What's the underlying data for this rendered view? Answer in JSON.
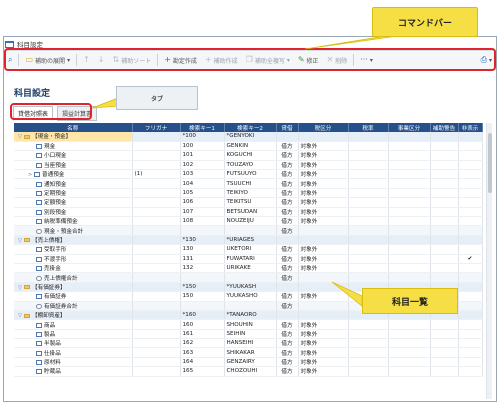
{
  "window": {
    "title": "科目設定"
  },
  "toolbar": {
    "items": [
      {
        "name": "search-icon",
        "label": "",
        "icon": "⌕",
        "dim": false
      },
      {
        "name": "expand-button",
        "label": "補助の展開",
        "icon": "▭",
        "dim": false,
        "caret": "▾"
      },
      {
        "name": "move-up-button",
        "label": "",
        "icon": "↑",
        "dim": true
      },
      {
        "name": "move-down-button",
        "label": "",
        "icon": "↓",
        "dim": true
      },
      {
        "name": "sub-sort-button",
        "label": "補助ソート",
        "icon": "⇅",
        "dim": true
      },
      {
        "name": "new-item-button",
        "label": "勘定作成",
        "icon": "+",
        "dim": false
      },
      {
        "name": "sub-create-button",
        "label": "補助作成",
        "icon": "+",
        "dim": true
      },
      {
        "name": "sub-bulk-button",
        "label": "補助全複写",
        "icon": "❐",
        "dim": true,
        "caret": "▾"
      },
      {
        "name": "edit-button",
        "label": "修正",
        "icon": "✎",
        "dim": false
      },
      {
        "name": "delete-button",
        "label": "削除",
        "icon": "✕",
        "dim": true
      },
      {
        "name": "more-button",
        "label": "",
        "icon": "···",
        "dim": false,
        "caret": "▾"
      },
      {
        "name": "print-button",
        "label": "",
        "icon": "⎙",
        "dim": false,
        "caret": "▾"
      }
    ]
  },
  "page_title": "科目設定",
  "tabs": [
    {
      "label": "貸借対照表",
      "active": true
    },
    {
      "label": "損益計算書",
      "active": false
    }
  ],
  "callouts": {
    "command_bar": "コマンドバー",
    "tab": "タブ",
    "list": "科目一覧"
  },
  "table": {
    "headers": [
      "名称",
      "フリガナ",
      "検索キー1",
      "検索キー2",
      "貸借",
      "税区分",
      "税率",
      "事業区分",
      "補助警告",
      "非表示"
    ],
    "rows": [
      {
        "kind": "group",
        "toggle": "▽",
        "icon": "folder",
        "name": "【現金・預金】",
        "furigana": "",
        "key1": "*100",
        "key2": "*GENYOKI",
        "dc": "",
        "tax": "",
        "rate": "",
        "biz": "",
        "warn": "",
        "hide": "",
        "sel": true
      },
      {
        "kind": "item",
        "toggle": "",
        "icon": "row",
        "name": "現金",
        "furigana": "",
        "key1": "100",
        "key2": "GENKIN",
        "dc": "借方",
        "tax": "対象外",
        "rate": "",
        "biz": "",
        "warn": "",
        "hide": ""
      },
      {
        "kind": "item",
        "toggle": "",
        "icon": "row",
        "name": "小口現金",
        "furigana": "",
        "key1": "101",
        "key2": "KOGUCHI",
        "dc": "借方",
        "tax": "対象外",
        "rate": "",
        "biz": "",
        "warn": "",
        "hide": ""
      },
      {
        "kind": "item",
        "toggle": "",
        "icon": "row",
        "name": "当座預金",
        "furigana": "",
        "key1": "102",
        "key2": "TOUZAYO",
        "dc": "借方",
        "tax": "対象外",
        "rate": "",
        "biz": "",
        "warn": "",
        "hide": ""
      },
      {
        "kind": "item",
        "toggle": ">",
        "icon": "row",
        "name": "普通預金",
        "furigana": "(1)",
        "key1": "103",
        "key2": "FUTSUUYO",
        "dc": "借方",
        "tax": "対象外",
        "rate": "",
        "biz": "",
        "warn": "",
        "hide": ""
      },
      {
        "kind": "item",
        "toggle": "",
        "icon": "row",
        "name": "通知預金",
        "furigana": "",
        "key1": "104",
        "key2": "TSUUCHI",
        "dc": "借方",
        "tax": "対象外",
        "rate": "",
        "biz": "",
        "warn": "",
        "hide": ""
      },
      {
        "kind": "item",
        "toggle": "",
        "icon": "row",
        "name": "定期預金",
        "furigana": "",
        "key1": "105",
        "key2": "TEIKIYO",
        "dc": "借方",
        "tax": "対象外",
        "rate": "",
        "biz": "",
        "warn": "",
        "hide": ""
      },
      {
        "kind": "item",
        "toggle": "",
        "icon": "row",
        "name": "定額預金",
        "furigana": "",
        "key1": "106",
        "key2": "TEIKITSU",
        "dc": "借方",
        "tax": "対象外",
        "rate": "",
        "biz": "",
        "warn": "",
        "hide": ""
      },
      {
        "kind": "item",
        "toggle": "",
        "icon": "row",
        "name": "別段預金",
        "furigana": "",
        "key1": "107",
        "key2": "BETSUDAN",
        "dc": "借方",
        "tax": "対象外",
        "rate": "",
        "biz": "",
        "warn": "",
        "hide": ""
      },
      {
        "kind": "item",
        "toggle": "",
        "icon": "row",
        "name": "納税準備預金",
        "furigana": "",
        "key1": "108",
        "key2": "NOUZEIJU",
        "dc": "借方",
        "tax": "対象外",
        "rate": "",
        "biz": "",
        "warn": "",
        "hide": ""
      },
      {
        "kind": "sub",
        "toggle": "",
        "icon": "sum",
        "name": "現金・預金合計",
        "furigana": "",
        "key1": "",
        "key2": "",
        "dc": "借方",
        "tax": "",
        "rate": "",
        "biz": "",
        "warn": "",
        "hide": ""
      },
      {
        "kind": "group",
        "toggle": "▽",
        "icon": "folder",
        "name": "【売上債権】",
        "furigana": "",
        "key1": "*130",
        "key2": "*URIAGES",
        "dc": "",
        "tax": "",
        "rate": "",
        "biz": "",
        "warn": "",
        "hide": ""
      },
      {
        "kind": "item",
        "toggle": "",
        "icon": "row",
        "name": "受取手形",
        "furigana": "",
        "key1": "130",
        "key2": "UKETORI",
        "dc": "借方",
        "tax": "対象外",
        "rate": "",
        "biz": "",
        "warn": "",
        "hide": ""
      },
      {
        "kind": "item",
        "toggle": "",
        "icon": "row",
        "name": "不渡手形",
        "furigana": "",
        "key1": "131",
        "key2": "FUWATARI",
        "dc": "借方",
        "tax": "対象外",
        "rate": "",
        "biz": "",
        "warn": "",
        "hide": "✔"
      },
      {
        "kind": "item",
        "toggle": "",
        "icon": "row",
        "name": "売掛金",
        "furigana": "",
        "key1": "132",
        "key2": "URIKAKE",
        "dc": "借方",
        "tax": "対象外",
        "rate": "",
        "biz": "",
        "warn": "",
        "hide": ""
      },
      {
        "kind": "sub",
        "toggle": "",
        "icon": "sum",
        "name": "売上債権合計",
        "furigana": "",
        "key1": "",
        "key2": "",
        "dc": "借方",
        "tax": "",
        "rate": "",
        "biz": "",
        "warn": "",
        "hide": ""
      },
      {
        "kind": "group",
        "toggle": "▽",
        "icon": "folder",
        "name": "【有価証券】",
        "furigana": "",
        "key1": "*150",
        "key2": "*YUUKASH",
        "dc": "",
        "tax": "",
        "rate": "",
        "biz": "",
        "warn": "",
        "hide": ""
      },
      {
        "kind": "item",
        "toggle": "",
        "icon": "row",
        "name": "有価証券",
        "furigana": "",
        "key1": "150",
        "key2": "YUUKASHO",
        "dc": "借方",
        "tax": "対象外",
        "rate": "",
        "biz": "",
        "warn": "",
        "hide": ""
      },
      {
        "kind": "sub",
        "toggle": "",
        "icon": "sum",
        "name": "有価証券合計",
        "furigana": "",
        "key1": "",
        "key2": "",
        "dc": "借方",
        "tax": "",
        "rate": "",
        "biz": "",
        "warn": "",
        "hide": ""
      },
      {
        "kind": "group",
        "toggle": "▽",
        "icon": "folder",
        "name": "【棚卸資産】",
        "furigana": "",
        "key1": "*160",
        "key2": "*TANAORO",
        "dc": "",
        "tax": "",
        "rate": "",
        "biz": "",
        "warn": "",
        "hide": ""
      },
      {
        "kind": "item",
        "toggle": "",
        "icon": "row",
        "name": "商品",
        "furigana": "",
        "key1": "160",
        "key2": "SHOUHIN",
        "dc": "借方",
        "tax": "対象外",
        "rate": "",
        "biz": "",
        "warn": "",
        "hide": ""
      },
      {
        "kind": "item",
        "toggle": "",
        "icon": "row",
        "name": "製品",
        "furigana": "",
        "key1": "161",
        "key2": "SEIHIN",
        "dc": "借方",
        "tax": "対象外",
        "rate": "",
        "biz": "",
        "warn": "",
        "hide": ""
      },
      {
        "kind": "item",
        "toggle": "",
        "icon": "row",
        "name": "半製品",
        "furigana": "",
        "key1": "162",
        "key2": "HANSEIHI",
        "dc": "借方",
        "tax": "対象外",
        "rate": "",
        "biz": "",
        "warn": "",
        "hide": ""
      },
      {
        "kind": "item",
        "toggle": "",
        "icon": "row",
        "name": "仕掛品",
        "furigana": "",
        "key1": "163",
        "key2": "SHIKAKAR",
        "dc": "借方",
        "tax": "対象外",
        "rate": "",
        "biz": "",
        "warn": "",
        "hide": ""
      },
      {
        "kind": "item",
        "toggle": "",
        "icon": "row",
        "name": "原材料",
        "furigana": "",
        "key1": "164",
        "key2": "GENZAIRY",
        "dc": "借方",
        "tax": "対象外",
        "rate": "",
        "biz": "",
        "warn": "",
        "hide": ""
      },
      {
        "kind": "item",
        "toggle": "",
        "icon": "row",
        "name": "貯蔵品",
        "furigana": "",
        "key1": "165",
        "key2": "CHOZOUHI",
        "dc": "借方",
        "tax": "対象外",
        "rate": "",
        "biz": "",
        "warn": "",
        "hide": ""
      }
    ]
  },
  "colors": {
    "header": "#25508a",
    "highlight": "#e0242d",
    "callout": "#f6df45",
    "group_row": "#e6eef8"
  }
}
